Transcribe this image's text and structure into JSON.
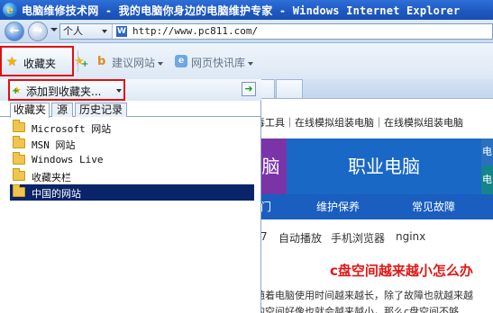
{
  "window": {
    "title": "电脑维修技术网 - 我的电脑你身边的电脑维护专家 - Windows Internet Explorer",
    "app_icon": "ie-logo-icon"
  },
  "address_bar": {
    "mode_label": "个人",
    "favicon_letter": "W",
    "url": "http://www.pc811.com/"
  },
  "favorites_bar": {
    "favorites_label": "收藏夹",
    "suggested_sites_label": "建议网站",
    "web_slices_label": "网页快讯库"
  },
  "favorites_panel": {
    "add_to_favorites_label": "添加到收藏夹...",
    "pin_label": "+",
    "tabs": [
      {
        "label": "收藏夹",
        "active": true
      },
      {
        "label": "源",
        "active": false
      },
      {
        "label": "历史记录",
        "active": false
      }
    ],
    "folders": [
      {
        "name": "Microsoft 网站",
        "selected": false
      },
      {
        "name": "MSN 网站",
        "selected": false
      },
      {
        "name": "Windows Live",
        "selected": false
      },
      {
        "name": "收藏夹栏",
        "selected": false
      },
      {
        "name": "中国的网站",
        "selected": true
      }
    ]
  },
  "webpage": {
    "top_links": "毒工具｜在线模拟组装电脑｜在线模拟组装电脑",
    "banner_left": "脑",
    "banner_main": "职业电脑",
    "banner_right_top": "电",
    "banner_right_bottom": "电",
    "categories": [
      "门",
      "维护保养",
      "常见故障"
    ],
    "tags": [
      "7",
      "自动播放",
      "手机浏览器",
      "nginx"
    ],
    "headline": "c盘空间越来越小怎么办",
    "paragraph_lines": [
      "随着电脑使用时间越来越长，除了故障也就越来越",
      "的空间好像也就会越来越小，那么c盘空间不够"
    ]
  },
  "colors": {
    "title_bar": "#1d57bf",
    "highlight_border": "#e01010",
    "selected_item": "#0a246a",
    "banner_purple": "#7a34a8",
    "banner_blue": "#1a68c6",
    "headline_red": "#e01818"
  }
}
